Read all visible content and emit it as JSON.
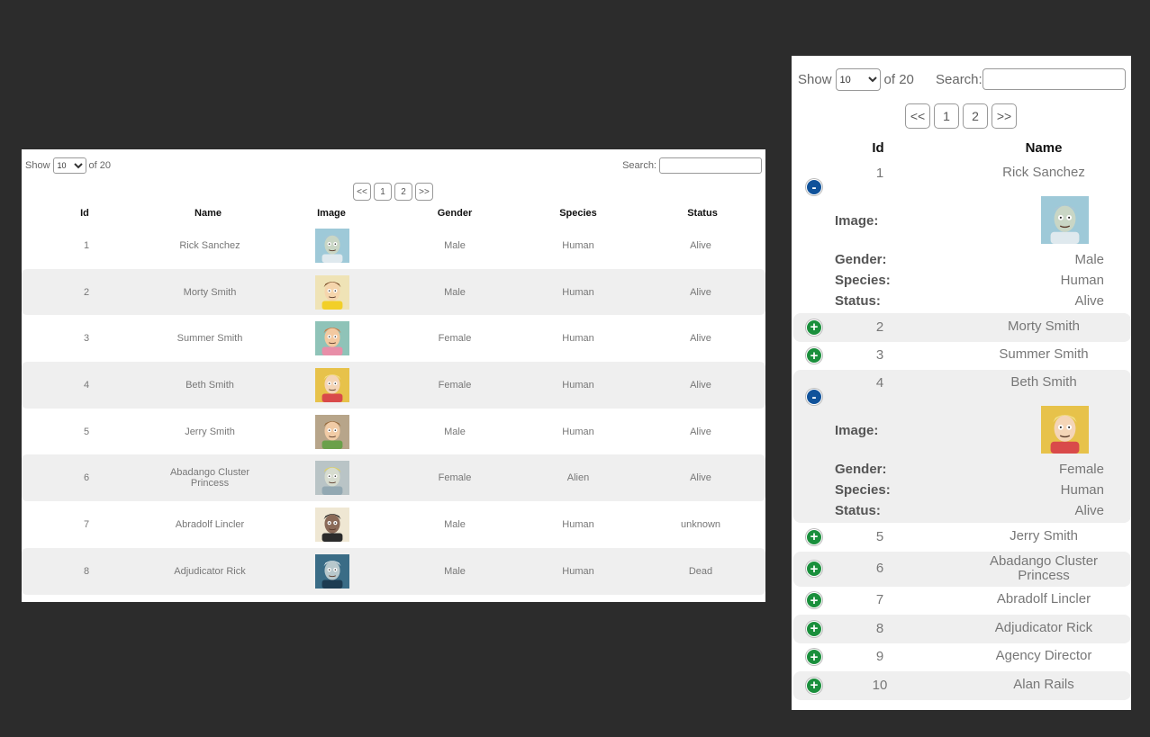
{
  "desktop": {
    "show_label": "Show",
    "page_size": "10",
    "of_label": "of 20",
    "search_label": "Search:",
    "pager": [
      "<<",
      "1",
      "2",
      ">>"
    ],
    "columns": [
      "Id",
      "Name",
      "Image",
      "Gender",
      "Species",
      "Status"
    ],
    "rows": [
      {
        "id": "1",
        "name": "Rick Sanchez",
        "gender": "Male",
        "species": "Human",
        "status": "Alive"
      },
      {
        "id": "2",
        "name": "Morty Smith",
        "gender": "Male",
        "species": "Human",
        "status": "Alive"
      },
      {
        "id": "3",
        "name": "Summer Smith",
        "gender": "Female",
        "species": "Human",
        "status": "Alive"
      },
      {
        "id": "4",
        "name": "Beth Smith",
        "gender": "Female",
        "species": "Human",
        "status": "Alive"
      },
      {
        "id": "5",
        "name": "Jerry Smith",
        "gender": "Male",
        "species": "Human",
        "status": "Alive"
      },
      {
        "id": "6",
        "name": "Abadango Cluster Princess",
        "gender": "Female",
        "species": "Alien",
        "status": "Alive"
      },
      {
        "id": "7",
        "name": "Abradolf Lincler",
        "gender": "Male",
        "species": "Human",
        "status": "unknown"
      },
      {
        "id": "8",
        "name": "Adjudicator Rick",
        "gender": "Male",
        "species": "Human",
        "status": "Dead"
      }
    ]
  },
  "mobile": {
    "show_label": "Show",
    "page_size": "10",
    "of_label": "of 20",
    "search_label": "Search:",
    "pager": [
      "<<",
      "1",
      "2",
      ">>"
    ],
    "columns": [
      "Id",
      "Name"
    ],
    "detail_labels": {
      "image": "Image:",
      "gender": "Gender:",
      "species": "Species:",
      "status": "Status:"
    },
    "toggle_plus": "+",
    "toggle_minus": "-",
    "rows": [
      {
        "id": "1",
        "name": "Rick Sanchez",
        "expanded": true,
        "gender": "Male",
        "species": "Human",
        "status": "Alive"
      },
      {
        "id": "2",
        "name": "Morty Smith",
        "expanded": false
      },
      {
        "id": "3",
        "name": "Summer Smith",
        "expanded": false
      },
      {
        "id": "4",
        "name": "Beth Smith",
        "expanded": true,
        "gender": "Female",
        "species": "Human",
        "status": "Alive"
      },
      {
        "id": "5",
        "name": "Jerry Smith",
        "expanded": false
      },
      {
        "id": "6",
        "name": "Abadango Cluster Princess",
        "expanded": false
      },
      {
        "id": "7",
        "name": "Abradolf Lincler",
        "expanded": false
      },
      {
        "id": "8",
        "name": "Adjudicator Rick",
        "expanded": false
      },
      {
        "id": "9",
        "name": "Agency Director",
        "expanded": false
      },
      {
        "id": "10",
        "name": "Alan Rails",
        "expanded": false
      }
    ]
  },
  "colors": {
    "page_bg": "#2c2c2c",
    "row_shade": "#efefef",
    "toggle_plus": "#1a8f3c",
    "toggle_minus": "#10529a"
  }
}
